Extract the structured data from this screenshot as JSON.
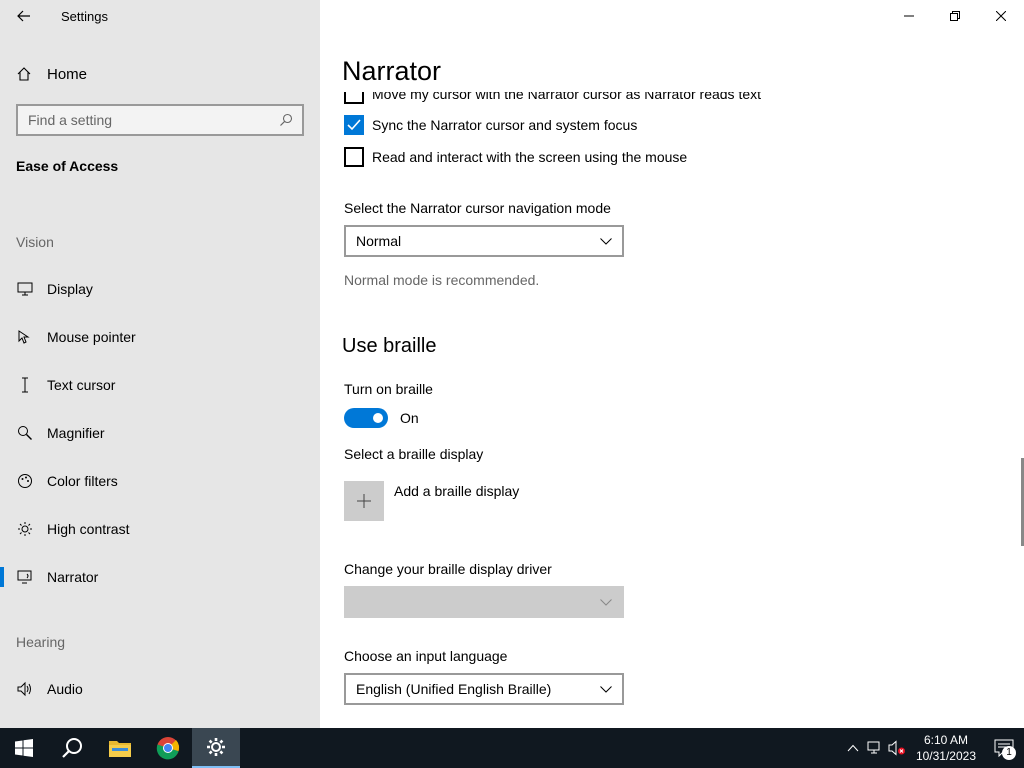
{
  "window": {
    "title": "Settings"
  },
  "sidebar": {
    "home_label": "Home",
    "search_placeholder": "Find a setting",
    "section_title": "Ease of Access",
    "vision_header": "Vision",
    "hearing_header": "Hearing",
    "items": [
      {
        "label": "Display",
        "icon": "display-icon"
      },
      {
        "label": "Mouse pointer",
        "icon": "mouse-pointer-icon"
      },
      {
        "label": "Text cursor",
        "icon": "text-cursor-icon"
      },
      {
        "label": "Magnifier",
        "icon": "magnifier-icon"
      },
      {
        "label": "Color filters",
        "icon": "color-filters-icon"
      },
      {
        "label": "High contrast",
        "icon": "high-contrast-icon"
      },
      {
        "label": "Narrator",
        "icon": "narrator-icon",
        "selected": true
      },
      {
        "label": "Audio",
        "icon": "audio-icon"
      }
    ]
  },
  "main": {
    "title": "Narrator",
    "checkboxes": [
      {
        "label": "Move my cursor with the Narrator cursor as Narrator reads text",
        "checked": false
      },
      {
        "label": "Sync the Narrator cursor and system focus",
        "checked": true
      },
      {
        "label": "Read and interact with the screen using the mouse",
        "checked": false
      }
    ],
    "nav_mode": {
      "label": "Select the Narrator cursor navigation mode",
      "value": "Normal",
      "hint": "Normal mode is recommended."
    },
    "braille": {
      "heading": "Use braille",
      "toggle_label": "Turn on braille",
      "toggle_state": "On",
      "select_display_label": "Select a braille display",
      "add_display_label": "Add a braille display",
      "driver_label": "Change your braille display driver",
      "driver_value": "",
      "input_language_label": "Choose an input language",
      "input_language_value": "English (Unified English Braille)"
    }
  },
  "taskbar": {
    "apps": [
      "start-icon",
      "search-icon",
      "file-explorer-icon",
      "chrome-icon",
      "settings-icon"
    ],
    "time": "6:10 AM",
    "date": "10/31/2023",
    "notification_count": "1"
  },
  "colors": {
    "accent": "#0078d7",
    "sidebar_bg": "#e6e6e6",
    "taskbar_bg": "#101820"
  }
}
